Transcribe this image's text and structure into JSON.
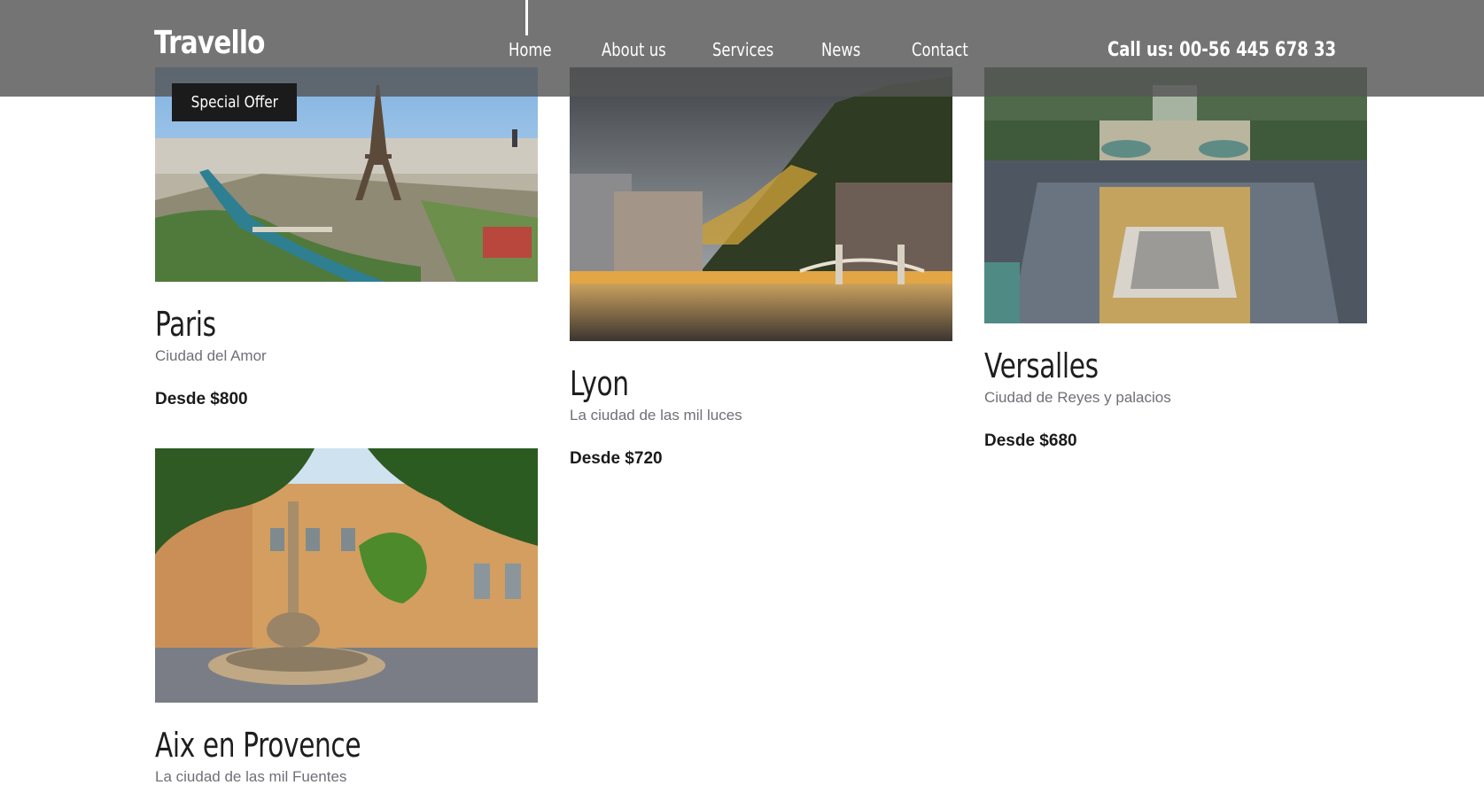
{
  "header": {
    "logo": "Travello",
    "nav": [
      {
        "label": "Home",
        "active": true
      },
      {
        "label": "About us",
        "active": false
      },
      {
        "label": "Services",
        "active": false
      },
      {
        "label": "News",
        "active": false
      },
      {
        "label": "Contact",
        "active": false
      }
    ],
    "phone": "Call us: 00-56 445 678 33"
  },
  "badge": "Special Offer",
  "destinations": [
    {
      "title": "Paris",
      "subtitle": "Ciudad del Amor",
      "price": "Desde $800",
      "image": "paris-eiffel-tower-photo"
    },
    {
      "title": "Lyon",
      "subtitle": "La ciudad de las mil luces",
      "price": "Desde $720",
      "image": "lyon-river-bridge-photo"
    },
    {
      "title": "Versalles",
      "subtitle": "Ciudad de Reyes y palacios",
      "price": "Desde $680",
      "image": "versailles-palace-photo"
    },
    {
      "title": "Aix en Provence",
      "subtitle": "La ciudad de las mil Fuentes",
      "price": "",
      "image": "aix-fountain-square-photo"
    }
  ],
  "colors": {
    "header_bg": "#555555",
    "badge_bg": "#1b1b1b",
    "title": "#1e1e1e",
    "subtitle": "#6f6f78"
  }
}
